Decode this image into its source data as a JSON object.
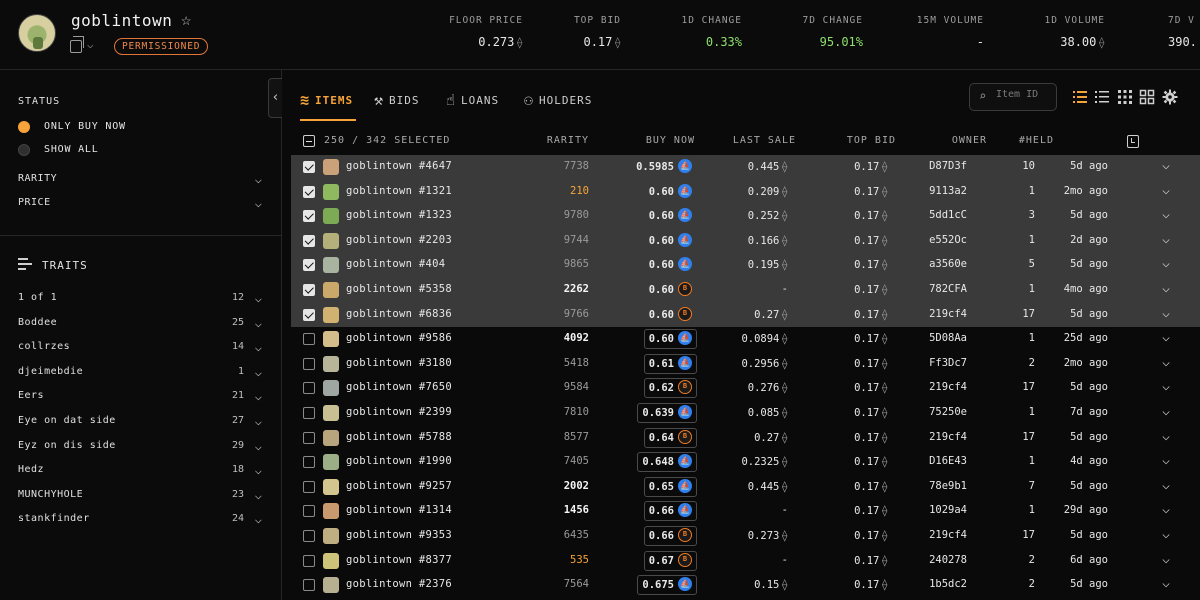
{
  "collection": {
    "name": "goblintown",
    "badge": "PERMISSIONED"
  },
  "stats": [
    {
      "label": "FLOOR PRICE",
      "value": "0.273",
      "eth": true,
      "green": false
    },
    {
      "label": "TOP BID",
      "value": "0.17",
      "eth": true,
      "green": false
    },
    {
      "label": "1D CHANGE",
      "value": "0.33%",
      "eth": false,
      "green": true
    },
    {
      "label": "7D CHANGE",
      "value": "95.01%",
      "eth": false,
      "green": true
    },
    {
      "label": "15M VOLUME",
      "value": "-",
      "eth": false,
      "green": false
    },
    {
      "label": "1D VOLUME",
      "value": "38.00",
      "eth": true,
      "green": false
    },
    {
      "label": "7D V",
      "value": "390.",
      "eth": false,
      "green": false
    }
  ],
  "sidebar": {
    "status_title": "STATUS",
    "status_options": [
      {
        "label": "ONLY BUY NOW",
        "selected": true
      },
      {
        "label": "SHOW ALL",
        "selected": false
      }
    ],
    "filters": [
      "RARITY",
      "PRICE"
    ],
    "traits_title": "TRAITS",
    "traits": [
      {
        "name": "1 of 1",
        "count": "12"
      },
      {
        "name": "Boddee",
        "count": "25"
      },
      {
        "name": "collrzes",
        "count": "14"
      },
      {
        "name": "djeimebdie",
        "count": "1"
      },
      {
        "name": "Eers",
        "count": "21"
      },
      {
        "name": "Eye on dat side",
        "count": "27"
      },
      {
        "name": "Eyz on dis side",
        "count": "29"
      },
      {
        "name": "Hedz",
        "count": "18"
      },
      {
        "name": "MUNCHYHOLE",
        "count": "23"
      },
      {
        "name": "stankfinder",
        "count": "24"
      }
    ]
  },
  "tabs": [
    {
      "label": "ITEMS",
      "icon": "stack-icon",
      "active": true
    },
    {
      "label": "BIDS",
      "icon": "gavel-icon",
      "active": false
    },
    {
      "label": "LOANS",
      "icon": "hand-coin-icon",
      "active": false
    },
    {
      "label": "HOLDERS",
      "icon": "users-icon",
      "active": false
    }
  ],
  "search": {
    "placeholder": "Item ID",
    "value": ""
  },
  "table": {
    "selection": "250 / 342 SELECTED",
    "headers": {
      "rarity": "RARITY",
      "buy_now": "BUY NOW",
      "last_sale": "LAST SALE",
      "top_bid": "TOP BID",
      "owner": "OWNER",
      "held": "#HELD"
    },
    "rows": [
      {
        "name": "goblintown #4647",
        "rarity": "7738",
        "rarity_style": "dim",
        "buy_now": "0.5985",
        "market": "os",
        "last_sale": "0.445",
        "top_bid": "0.17",
        "owner": "D87D3f",
        "held": "10",
        "ago": "5d ago",
        "selected": true,
        "thumb": "#c9a27a"
      },
      {
        "name": "goblintown #1321",
        "rarity": "210",
        "rarity_style": "orange",
        "buy_now": "0.60",
        "market": "os",
        "last_sale": "0.209",
        "top_bid": "0.17",
        "owner": "9113a2",
        "held": "1",
        "ago": "2mo ago",
        "selected": true,
        "thumb": "#8fb85f"
      },
      {
        "name": "goblintown #1323",
        "rarity": "9780",
        "rarity_style": "dim",
        "buy_now": "0.60",
        "market": "os",
        "last_sale": "0.252",
        "top_bid": "0.17",
        "owner": "5dd1cC",
        "held": "3",
        "ago": "5d ago",
        "selected": true,
        "thumb": "#7dab55"
      },
      {
        "name": "goblintown #2203",
        "rarity": "9744",
        "rarity_style": "dim",
        "buy_now": "0.60",
        "market": "os",
        "last_sale": "0.166",
        "top_bid": "0.17",
        "owner": "e552Oc",
        "held": "1",
        "ago": "2d ago",
        "selected": true,
        "thumb": "#b5b07a"
      },
      {
        "name": "goblintown #404",
        "rarity": "9865",
        "rarity_style": "dim",
        "buy_now": "0.60",
        "market": "os",
        "last_sale": "0.195",
        "top_bid": "0.17",
        "owner": "a3560e",
        "held": "5",
        "ago": "5d ago",
        "selected": true,
        "thumb": "#a8b3a0"
      },
      {
        "name": "goblintown #5358",
        "rarity": "2262",
        "rarity_style": "bright",
        "buy_now": "0.60",
        "market": "bl",
        "last_sale": "-",
        "top_bid": "0.17",
        "owner": "782CFA",
        "held": "1",
        "ago": "4mo ago",
        "selected": true,
        "thumb": "#c9a86a"
      },
      {
        "name": "goblintown #6836",
        "rarity": "9766",
        "rarity_style": "dim",
        "buy_now": "0.60",
        "market": "bl",
        "last_sale": "0.27",
        "top_bid": "0.17",
        "owner": "219cf4",
        "held": "17",
        "ago": "5d ago",
        "selected": true,
        "thumb": "#d1b271"
      },
      {
        "name": "goblintown #9586",
        "rarity": "4092",
        "rarity_style": "bright",
        "buy_now": "0.60",
        "market": "os",
        "last_sale": "0.0894",
        "top_bid": "0.17",
        "owner": "5D08Aa",
        "held": "1",
        "ago": "25d ago",
        "selected": false,
        "thumb": "#d4bd8a"
      },
      {
        "name": "goblintown #3180",
        "rarity": "5418",
        "rarity_style": "dim",
        "buy_now": "0.61",
        "market": "os",
        "last_sale": "0.2956",
        "top_bid": "0.17",
        "owner": "Ff3Dc7",
        "held": "2",
        "ago": "2mo ago",
        "selected": false,
        "thumb": "#b7b49a"
      },
      {
        "name": "goblintown #7650",
        "rarity": "9584",
        "rarity_style": "dim",
        "buy_now": "0.62",
        "market": "bl",
        "last_sale": "0.276",
        "top_bid": "0.17",
        "owner": "219cf4",
        "held": "17",
        "ago": "5d ago",
        "selected": false,
        "thumb": "#9fa7a3"
      },
      {
        "name": "goblintown #2399",
        "rarity": "7810",
        "rarity_style": "dim",
        "buy_now": "0.639",
        "market": "os",
        "last_sale": "0.085",
        "top_bid": "0.17",
        "owner": "75250e",
        "held": "1",
        "ago": "7d ago",
        "selected": false,
        "thumb": "#c8c093"
      },
      {
        "name": "goblintown #5788",
        "rarity": "8577",
        "rarity_style": "dim",
        "buy_now": "0.64",
        "market": "bl",
        "last_sale": "0.27",
        "top_bid": "0.17",
        "owner": "219cf4",
        "held": "17",
        "ago": "5d ago",
        "selected": false,
        "thumb": "#b9a57d"
      },
      {
        "name": "goblintown #1990",
        "rarity": "7405",
        "rarity_style": "dim",
        "buy_now": "0.648",
        "market": "os",
        "last_sale": "0.2325",
        "top_bid": "0.17",
        "owner": "D16E43",
        "held": "1",
        "ago": "4d ago",
        "selected": false,
        "thumb": "#9cae86"
      },
      {
        "name": "goblintown #9257",
        "rarity": "2002",
        "rarity_style": "bright",
        "buy_now": "0.65",
        "market": "os",
        "last_sale": "0.445",
        "top_bid": "0.17",
        "owner": "78e9b1",
        "held": "7",
        "ago": "5d ago",
        "selected": false,
        "thumb": "#d2c68e"
      },
      {
        "name": "goblintown #1314",
        "rarity": "1456",
        "rarity_style": "bright",
        "buy_now": "0.66",
        "market": "os",
        "last_sale": "-",
        "top_bid": "0.17",
        "owner": "1029a4",
        "held": "1",
        "ago": "29d ago",
        "selected": false,
        "thumb": "#c99a6e"
      },
      {
        "name": "goblintown #9353",
        "rarity": "6435",
        "rarity_style": "dim",
        "buy_now": "0.66",
        "market": "bl",
        "last_sale": "0.273",
        "top_bid": "0.17",
        "owner": "219cf4",
        "held": "17",
        "ago": "5d ago",
        "selected": false,
        "thumb": "#bfae82"
      },
      {
        "name": "goblintown #8377",
        "rarity": "535",
        "rarity_style": "orange",
        "buy_now": "0.67",
        "market": "bl",
        "last_sale": "-",
        "top_bid": "0.17",
        "owner": "240278",
        "held": "2",
        "ago": "6d ago",
        "selected": false,
        "thumb": "#cdc47a"
      },
      {
        "name": "goblintown #2376",
        "rarity": "7564",
        "rarity_style": "dim",
        "buy_now": "0.675",
        "market": "os",
        "last_sale": "0.15",
        "top_bid": "0.17",
        "owner": "1b5dc2",
        "held": "2",
        "ago": "5d ago",
        "selected": false,
        "thumb": "#b6b091"
      }
    ]
  }
}
